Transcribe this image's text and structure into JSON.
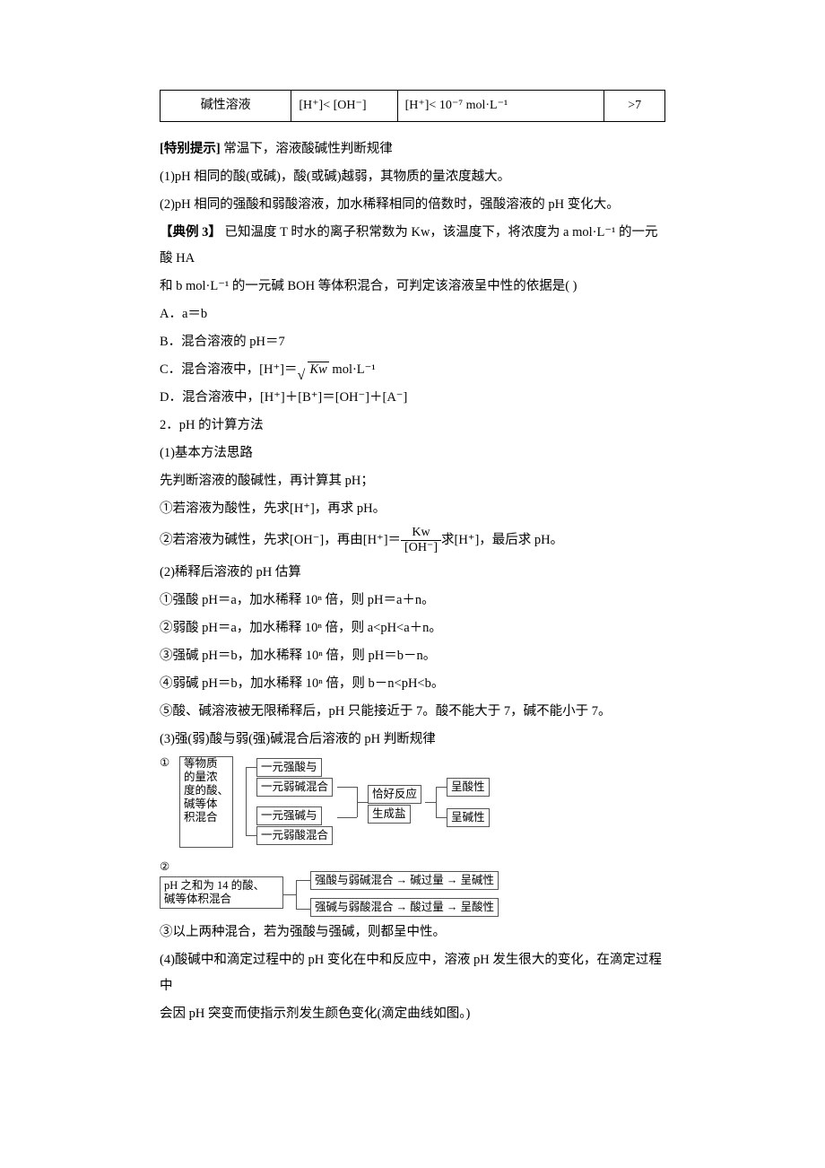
{
  "table": {
    "c1": "碱性溶液",
    "c2": "[H⁺]< [OH⁻]",
    "c3": "[H⁺]< 10⁻⁷ mol·L⁻¹",
    "c4": ">7"
  },
  "tips_head": "[特别提示]",
  "tips_title": " 常温下，溶液酸碱性判断规律",
  "tips1": "(1)pH 相同的酸(或碱)，酸(或碱)越弱，其物质的量浓度越大。",
  "tips2": "(2)pH 相同的强酸和弱酸溶液，加水稀释相同的倍数时，强酸溶液的 pH 变化大。",
  "ex3_head": "【典例 3】",
  "ex3_body1": " 已知温度 T 时水的离子积常数为 Kw，该温度下，将浓度为 a mol·L⁻¹ 的一元酸 HA",
  "ex3_body2": "和 b mol·L⁻¹ 的一元碱 BOH 等体积混合，可判定该溶液呈中性的依据是(      )",
  "optA": "A．a＝b",
  "optB": "B．混合溶液的 pH＝7",
  "optC_pre": "C．混合溶液中，[H⁺]＝",
  "optC_rad": "Kw",
  "optC_post": " mol·L⁻¹",
  "optD": "D．混合溶液中，[H⁺]＋[B⁺]＝[OH⁻]＋[A⁻]",
  "h2": "2．pH 的计算方法",
  "s1": "(1)基本方法思路",
  "s1a": "先判断溶液的酸碱性，再计算其 pH；",
  "s1b": "①若溶液为酸性，先求[H⁺]，再求 pH。",
  "s1c_pre": "②若溶液为碱性，先求[OH⁻]，再由[H⁺]＝",
  "s1c_num": "Kw",
  "s1c_den": "[OH⁻]",
  "s1c_post": "求[H⁺]，最后求 pH。",
  "s2": "(2)稀释后溶液的 pH 估算",
  "s2a": "①强酸 pH＝a，加水稀释 10ⁿ 倍，则 pH＝a＋n。",
  "s2b": "②弱酸 pH＝a，加水稀释 10ⁿ 倍，则 a<pH<a＋n。",
  "s2c": "③强碱 pH＝b，加水稀释 10ⁿ 倍，则 pH＝b－n。",
  "s2d": "④弱碱 pH＝b，加水稀释 10ⁿ 倍，则 b－n<pH<b。",
  "s2e": "⑤酸、碱溶液被无限稀释后，pH 只能接近于 7。酸不能大于 7，碱不能小于 7。",
  "s3": "(3)强(弱)酸与弱(强)碱混合后溶液的 pH 判断规律",
  "d1": {
    "num": "①",
    "left1": "等物质",
    "left2": "的量浓",
    "left3": "度的酸、",
    "left4": "碱等体",
    "left5": "积混合",
    "m1": "一元强酸与",
    "m2": "一元弱碱混合",
    "m3": "一元强碱与",
    "m4": "一元弱酸混合",
    "c1": "恰好反应",
    "c2": "生成盐",
    "r1": "呈酸性",
    "r2": "呈碱性"
  },
  "d2": {
    "num": "②",
    "left1": "pH 之和为 14 的酸、",
    "left2": "碱等体积混合",
    "r1": "强酸与弱碱混合 → 碱过量 → 呈碱性",
    "r2": "强碱与弱酸混合 → 酸过量 → 呈酸性"
  },
  "s3c": "③以上两种混合，若为强酸与强碱，则都呈中性。",
  "s4a": "(4)酸碱中和滴定过程中的 pH 变化在中和反应中，溶液 pH 发生很大的变化，在滴定过程中",
  "s4b": "会因 pH 突变而使指示剂发生颜色变化(滴定曲线如图。)"
}
